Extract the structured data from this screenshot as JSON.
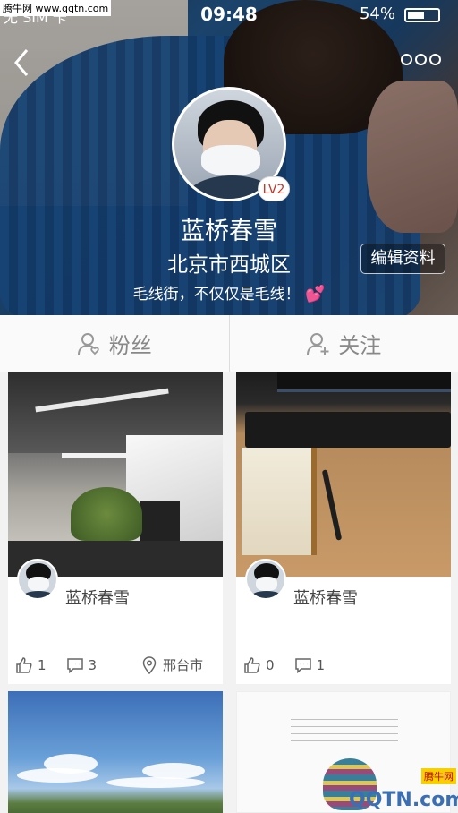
{
  "status_bar": {
    "carrier": "无 SIM 卡",
    "time": "09:48",
    "battery": "54%"
  },
  "watermark": "腾牛网 www.qqtn.com",
  "profile": {
    "name": "蓝桥春雪",
    "location": "北京市西城区",
    "bio": "毛线街，不仅仅是毛线！",
    "bio_emoji": "💕",
    "level": "LV2",
    "edit_label": "编辑资料"
  },
  "tabs": [
    {
      "label": "粉丝",
      "icon": "followers-icon"
    },
    {
      "label": "关注",
      "icon": "add-follow-icon"
    }
  ],
  "posts": [
    {
      "author": "蓝桥春雪",
      "likes": "1",
      "comments": "3",
      "location": "邢台市"
    },
    {
      "author": "蓝桥春雪",
      "likes": "0",
      "comments": "1",
      "location": ""
    }
  ],
  "footer_logo": {
    "tag": "腾牛网",
    "text": "QQTN.com"
  },
  "colors": {
    "accent": "#c0392b",
    "tab_text": "#888888",
    "badge_pink": "#ff6fb5",
    "logo_blue": "#3a6fb3"
  }
}
